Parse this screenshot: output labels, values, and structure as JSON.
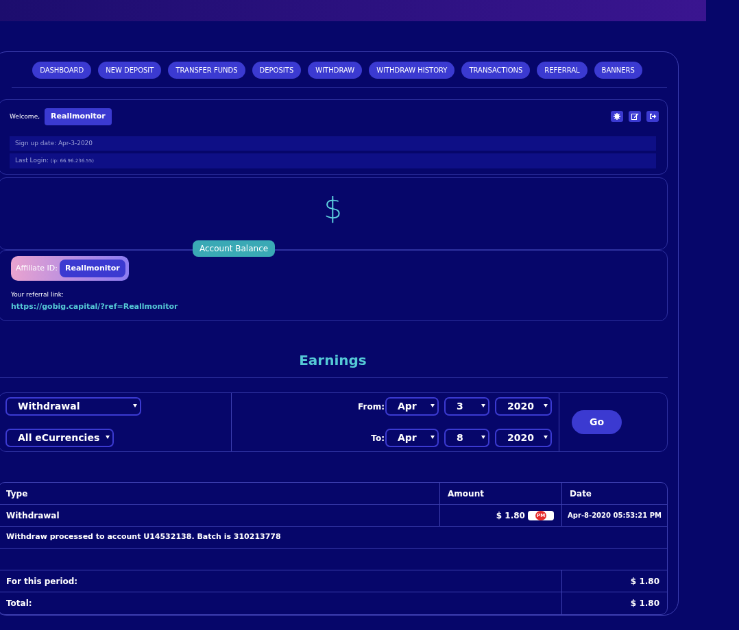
{
  "nav": [
    {
      "label": "DASHBOARD",
      "selected": false
    },
    {
      "label": "NEW DEPOSIT",
      "selected": false
    },
    {
      "label": "TRANSFER FUNDS",
      "selected": false
    },
    {
      "label": "DEPOSITS",
      "selected": false
    },
    {
      "label": "WITHDRAW",
      "selected": false
    },
    {
      "label": "WITHDRAW HISTORY",
      "selected": false
    },
    {
      "label": "TRANSACTIONS",
      "selected": false
    },
    {
      "label": "REFERRAL",
      "selected": false
    },
    {
      "label": "BANNERS",
      "selected": false
    }
  ],
  "account": {
    "welcome": "Welcome,",
    "username": "Reallmonitor",
    "signup_label": "Sign up date:",
    "signup_date": "Apr-3-2020",
    "last_login_label": "Last Login:",
    "last_login_ip": "(ip: 66.96.236.55)"
  },
  "balance": {
    "symbol": "$",
    "label": "Account Balance"
  },
  "affiliate": {
    "label": "Affiliate ID:",
    "id": "Reallmonitor",
    "link_label": "Your referral link:",
    "link": "https://gobig.capital/?ref=Reallmonitor"
  },
  "earnings": {
    "title": "Earnings",
    "filters": {
      "type": "Withdrawal",
      "currency": "All eCurrencies",
      "from_label": "From:",
      "from": [
        "Apr",
        "3",
        "2020"
      ],
      "to_label": "To:",
      "to": [
        "Apr",
        "8",
        "2020"
      ],
      "go": "Go"
    }
  },
  "table": {
    "columns": [
      "Type",
      "Amount",
      "Date"
    ],
    "rows": [
      {
        "type": "Withdrawal",
        "amount": "$ 1.80",
        "currency_badge": "PM",
        "date": "Apr-8-2020 05:53:21 PM",
        "note": "Withdraw processed to account U14532138. Batch is 310213778"
      }
    ],
    "period_label": "For this period:",
    "period_total": "$ 1.80",
    "total_label": "Total:",
    "total": "$ 1.80"
  }
}
